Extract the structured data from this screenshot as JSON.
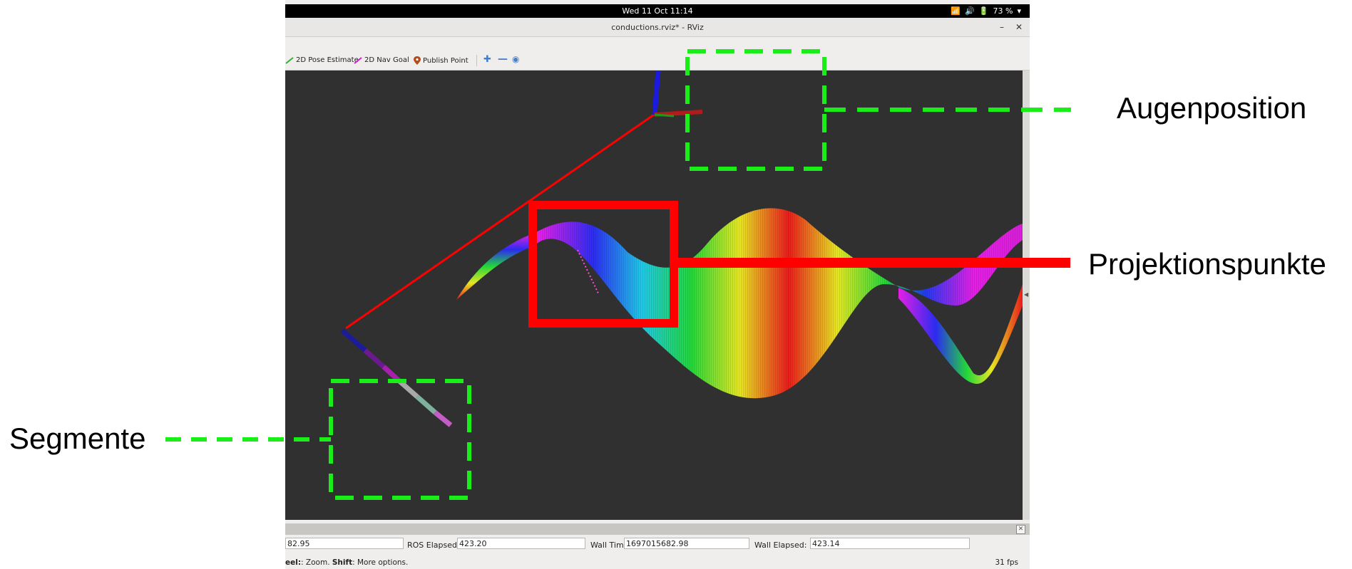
{
  "topbar": {
    "datetime": "Wed 11 Oct  11:14",
    "battery": "73 %"
  },
  "window": {
    "title": "conductions.rviz* - RViz",
    "minimize": "–",
    "close": "✕"
  },
  "toolbar": {
    "pose_estimate": "2D Pose Estimate",
    "nav_goal": "2D Nav Goal",
    "publish_point": "Publish Point"
  },
  "time_panel": {
    "ros_time_value": "82.95",
    "ros_elapsed_label": "ROS Elapsed:",
    "ros_elapsed_value": "423.20",
    "wall_time_label": "Wall Time:",
    "wall_time_value": "1697015682.98",
    "wall_elapsed_label": "Wall Elapsed:",
    "wall_elapsed_value": "423.14"
  },
  "statusbar": {
    "hint_prefix": "eel:",
    "hint_zoom": ": Zoom. ",
    "hint_shift": "Shift",
    "hint_more": ": More options.",
    "fps": "31 fps"
  },
  "annotations": {
    "eye_position": "Augenposition",
    "projection_points": "Projektionspunkte",
    "segments": "Segmente"
  },
  "colors": {
    "dashed_box": "#19ee19",
    "projection_box": "#ff0000",
    "viewport_bg": "#303030"
  }
}
